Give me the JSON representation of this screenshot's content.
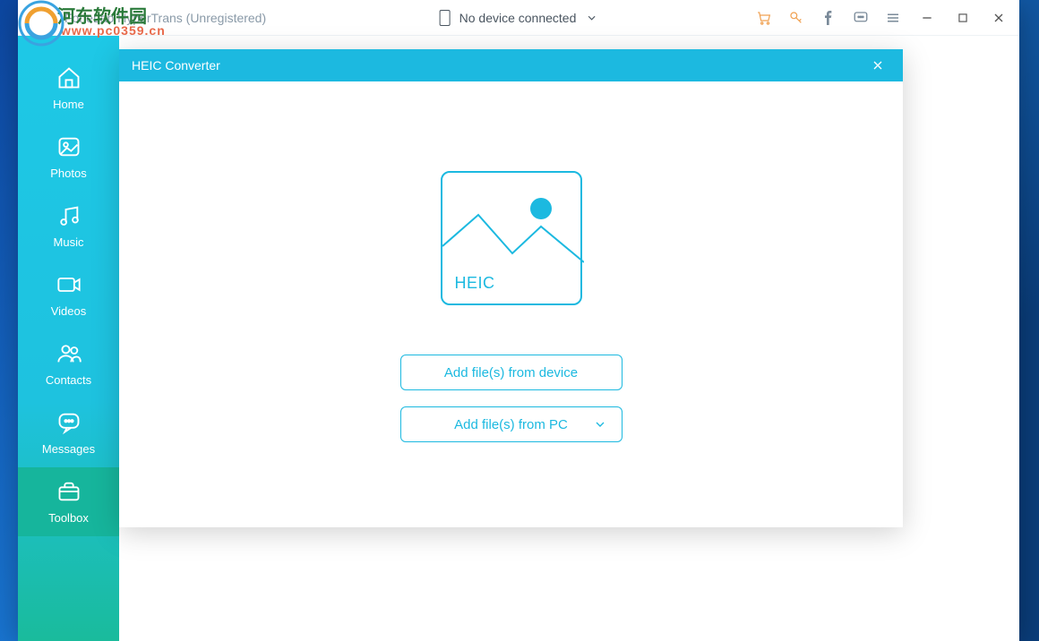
{
  "watermark": {
    "text1": "河东软件园",
    "text2": "www.pc0359.cn"
  },
  "titlebar": {
    "title": "FoneLab HyperTrans (Unregistered)",
    "device_label": "No device connected"
  },
  "sidebar": {
    "items": [
      {
        "label": "Home"
      },
      {
        "label": "Photos"
      },
      {
        "label": "Music"
      },
      {
        "label": "Videos"
      },
      {
        "label": "Contacts"
      },
      {
        "label": "Messages"
      },
      {
        "label": "Toolbox"
      }
    ]
  },
  "modal": {
    "title": "HEIC Converter",
    "heic_label": "HEIC",
    "btn_device": "Add file(s) from device",
    "btn_pc": "Add file(s) from PC"
  }
}
